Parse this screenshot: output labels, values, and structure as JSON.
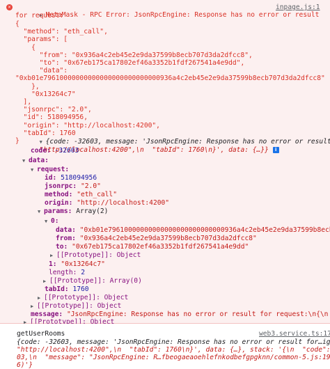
{
  "error": {
    "line1_prefix": "MetaMask - RPC Error: JsonRpcEngine: Response has no error or result",
    "line2": "for request:",
    "source_link": "inpage.js:1",
    "request_json": [
      "{",
      "  \"method\": \"eth_call\",",
      "  \"params\": [",
      "    {",
      "      \"from\": \"0x936a4c2eb45e2e9da37599b8ecb707d3da2dfcc8\",",
      "      \"to\": \"0x67eb175ca17802ef46a3352b1fdf267541a4e9dd\",",
      "      \"data\":",
      "\"0xb01e79610000000000000000000000000936a4c2eb45e2e9da37599b8ecb707d3da2dfcc8\"",
      "    },",
      "    \"0x13264c7\"",
      "  ],",
      "  \"jsonrpc\": \"2.0\",",
      "  \"id\": 518094956,",
      "  \"origin\": \"http://localhost:4200\",",
      "  \"tabId\": 1760",
      "}"
    ],
    "summary": "{code: -32603, message: 'JsonRpcEngine: Response has no error or result for…igin\": \"http://localhost:4200\",\\n  \"tabId\": 1760\\n}', data: {…}}",
    "summary_a": "{code: -32603, message: 'JsonRpcEngine: Response has no error or result for…igin\":",
    "summary_b": "\"http://localhost:4200\",\\n  \"tabId\": 1760\\n}', data: {…}}",
    "tree": {
      "code_key": "code:",
      "code_val": "-32603",
      "data_key": "data:",
      "request_key": "request:",
      "id_key": "id:",
      "id_val": "518094956",
      "jsonrpc_key": "jsonrpc:",
      "jsonrpc_val": "\"2.0\"",
      "method_key": "method:",
      "method_val": "\"eth_call\"",
      "origin_key": "origin:",
      "origin_val": "\"http://localhost:4200\"",
      "params_key": "params:",
      "params_val": "Array(2)",
      "idx0_key": "0:",
      "data_inner_key": "data:",
      "data_inner_val": "\"0xb01e79610000000000000000000000000936a4c2eb45e2e9da37599b8ecb707d3da2dfcc8\"",
      "from_key": "from:",
      "from_val": "\"0x936a4c2eb45e2e9da37599b8ecb707d3da2dfcc8\"",
      "to_key": "to:",
      "to_val": "\"0x67eb175ca17802ef46a3352b1fdf267541a4e9dd\"",
      "proto_obj1": "[[Prototype]]: Object",
      "idx1_key": "1:",
      "idx1_val": "\"0x13264c7\"",
      "length_key": "length:",
      "length_val": "2",
      "proto_arr": "[[Prototype]]: Array(0)",
      "tabid_key": "tabId:",
      "tabid_val": "1760",
      "proto_obj2": "[[Prototype]]: Object",
      "proto_obj3": "[[Prototype]]: Object",
      "message_key": "message:",
      "message_val": "\"JsonRpcEngine: Response has no error or result for request:\\n{\\n  \\\"met",
      "proto_obj4": "[[Prototype]]: Object"
    }
  },
  "log": {
    "label": "getUserRooms",
    "source_link": "web3.service.ts:174",
    "line_a": "{code: -32603, message: 'JsonRpcEngine: Response has no error or result for…igin\":",
    "line_b": "\"http://localhost:4200\",\\n  \"tabId\": 1760\\n}', data: {…}, stack: '{\\n  \"code\": -326",
    "line_c": "03,\\n  \"message\": \"JsonRpcEngine: R…fbeogaeaoehlefnkodbefgpgknn/common-5.js:19:39007",
    "line_d": "6)'}"
  },
  "colors": {
    "error_bg": "#fcf0f0",
    "error_text": "#d93025",
    "string": "#c41a16",
    "number": "#1a1aa6",
    "key": "#881280"
  },
  "icons": {
    "error": "error-x-icon",
    "expand": "triangle-right-icon",
    "collapse": "triangle-down-icon",
    "info": "info-badge-icon"
  }
}
